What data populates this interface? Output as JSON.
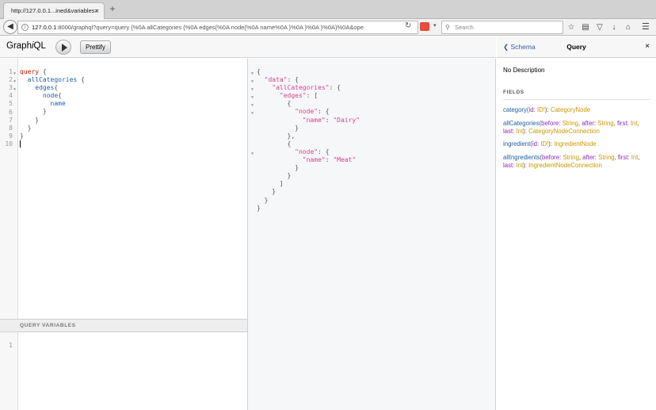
{
  "browser": {
    "tab_title": "http://127.0.0.1...ined&variables=",
    "tab_close": "×",
    "new_tab": "+",
    "url_host": "127.0.0.1",
    "url_rest": ":8000/graphql?query=query {%0A  allCategories {%0A    edges{%0A      node{%0A        name%0A      }%0A    }%0A  }%0A}%0A&ope",
    "search_placeholder": "Search"
  },
  "graphiql": {
    "logo_prefix": "Graph",
    "logo_italic": "i",
    "logo_suffix": "QL",
    "prettify_label": "Prettify",
    "query_variables_label": "QUERY VARIABLES",
    "variables_line_number": "1",
    "query_lines": [
      {
        "n": "1",
        "fold": true
      },
      {
        "n": "2",
        "fold": true
      },
      {
        "n": "3",
        "fold": true
      },
      {
        "n": "4",
        "fold": false
      },
      {
        "n": "5",
        "fold": false
      },
      {
        "n": "6",
        "fold": false
      },
      {
        "n": "7",
        "fold": false
      },
      {
        "n": "8",
        "fold": false
      },
      {
        "n": "9",
        "fold": false
      },
      {
        "n": "10",
        "fold": false
      }
    ],
    "query_tokens": {
      "query_kw": "query",
      "all_categories": "allCategories",
      "edges": "edges",
      "node": "node",
      "name": "name"
    },
    "result_tokens": {
      "data_key": "\"data\"",
      "all_categories_key": "\"allCategories\"",
      "edges_key": "\"edges\"",
      "node_key": "\"node\"",
      "name_key": "\"name\"",
      "value_dairy": "\"Dairy\"",
      "value_meat": "\"Meat\""
    }
  },
  "docs": {
    "back_label": "Schema",
    "title": "Query",
    "close": "×",
    "description": "No Description",
    "fields_header": "FIELDS",
    "fields": [
      {
        "name": "category",
        "args": [
          {
            "name": "id",
            "type": "ID!"
          }
        ],
        "type": "CategoryNode"
      },
      {
        "name": "allCategories",
        "args": [
          {
            "name": "before",
            "type": "String"
          },
          {
            "name": "after",
            "type": "String"
          },
          {
            "name": "first",
            "type": "Int"
          },
          {
            "name": "last",
            "type": "Int"
          }
        ],
        "type": "CategoryNodeConnection"
      },
      {
        "name": "ingredient",
        "args": [
          {
            "name": "id",
            "type": "ID!"
          }
        ],
        "type": "IngredientNode"
      },
      {
        "name": "allIngredients",
        "args": [
          {
            "name": "before",
            "type": "String"
          },
          {
            "name": "after",
            "type": "String"
          },
          {
            "name": "first",
            "type": "Int"
          },
          {
            "name": "last",
            "type": "Int"
          }
        ],
        "type": "IngredientNodeConnection"
      }
    ]
  }
}
